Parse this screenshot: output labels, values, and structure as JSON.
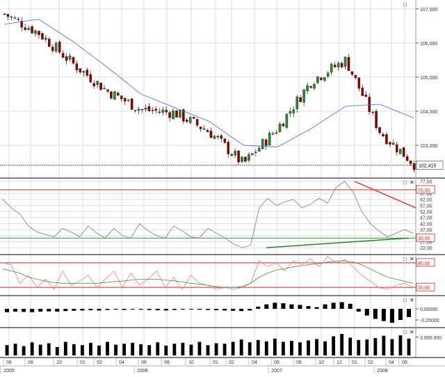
{
  "colors": {
    "candle_up": "#2f8a2f",
    "candle_down": "#8b0000",
    "ma": "#5577dd",
    "rsi_line": "#7a7a7a",
    "stoch_k": "#ff7b7b",
    "stoch_d": "#4a8f4a",
    "hist": "#000000",
    "volume": "#000000",
    "level_red": "#dd2222",
    "level_green": "#2a9a2a",
    "grid": "#dddddd",
    "axis_text": "#333333"
  },
  "chart_data": [
    {
      "type": "candlestick",
      "name": "price",
      "ylim": [
        102.1,
        107.2
      ],
      "ticks": [
        "107,000",
        "106,000",
        "105,000",
        "104,000",
        "103,000"
      ],
      "tick_values": [
        107.0,
        106.0,
        105.0,
        104.0,
        103.0
      ],
      "last_price_label": "102,415",
      "last_price": 102.415,
      "close_path": [
        106.85,
        106.3,
        105.4,
        104.6,
        104.05,
        103.95,
        103.4,
        102.45,
        103.5,
        104.9,
        105.5,
        103.4,
        102.45
      ],
      "ma_path": [
        106.55,
        106.7,
        106.05,
        105.3,
        104.5,
        104.1,
        103.7,
        103.0,
        102.95,
        103.5,
        104.15,
        104.2,
        103.8
      ]
    },
    {
      "type": "line",
      "name": "rsi",
      "ylim": [
        18,
        78
      ],
      "ticks": [
        "77,00",
        "67,00",
        "62,00",
        "57,00",
        "52,00",
        "47,00",
        "42,00",
        "37,00",
        "32,00",
        "27,00",
        "22,00"
      ],
      "tick_values": [
        77,
        67,
        62,
        57,
        52,
        47,
        42,
        37,
        32,
        27,
        22
      ],
      "levels": {
        "upper": 70,
        "lower": 30,
        "upper_label": "70,00",
        "lower_label": "30,00"
      },
      "values": [
        62,
        55,
        50,
        40,
        35,
        33,
        31,
        38,
        35,
        31,
        40,
        34,
        30,
        38,
        32,
        30,
        42,
        36,
        32,
        30,
        40,
        36,
        31,
        30,
        38,
        34,
        30,
        25,
        22,
        24,
        55,
        63,
        57,
        60,
        62,
        55,
        58,
        63,
        59,
        72,
        77,
        68,
        52,
        42,
        36,
        31,
        34,
        37,
        34
      ]
    },
    {
      "type": "line",
      "name": "stochastic",
      "ylim": [
        5,
        95
      ],
      "ticks": [
        "80,00",
        "20,00"
      ],
      "tick_values": [
        80,
        20
      ],
      "levels": {
        "upper": 80,
        "lower": 20,
        "upper_label": "80,00",
        "lower_label": "20,00"
      },
      "k_values": [
        80,
        75,
        30,
        50,
        20,
        40,
        15,
        60,
        25,
        35,
        50,
        20,
        40,
        60,
        20,
        55,
        25,
        40,
        60,
        20,
        45,
        15,
        50,
        30,
        25,
        15,
        20,
        15,
        20,
        30,
        85,
        70,
        80,
        60,
        85,
        75,
        90,
        70,
        95,
        80,
        88,
        70,
        50,
        35,
        20,
        15,
        25,
        30,
        20
      ],
      "d_values": [
        65,
        60,
        55,
        45,
        40,
        35,
        32,
        30,
        30,
        30,
        30,
        30,
        32,
        34,
        35,
        38,
        40,
        40,
        40,
        38,
        36,
        33,
        30,
        28,
        25,
        22,
        20,
        20,
        22,
        30,
        45,
        55,
        62,
        66,
        70,
        73,
        76,
        78,
        82,
        84,
        85,
        82,
        75,
        65,
        55,
        45,
        40,
        35,
        30
      ]
    },
    {
      "type": "bar",
      "name": "macd-histogram",
      "ylim": [
        -0.3,
        0.2
      ],
      "ticks": [
        "0,00000",
        "-0,20000"
      ],
      "tick_values": [
        0.0,
        -0.2
      ],
      "values": [
        -0.06,
        -0.05,
        -0.055,
        -0.06,
        -0.05,
        -0.045,
        -0.05,
        -0.04,
        -0.035,
        -0.03,
        -0.025,
        -0.03,
        -0.02,
        -0.015,
        -0.02,
        -0.01,
        -0.015,
        -0.02,
        -0.025,
        -0.03,
        -0.02,
        -0.015,
        -0.01,
        -0.015,
        -0.02,
        -0.025,
        -0.03,
        -0.035,
        -0.04,
        -0.03,
        0.04,
        0.08,
        0.11,
        0.1,
        0.08,
        0.07,
        0.05,
        0.03,
        0.08,
        0.11,
        0.12,
        0.09,
        -0.05,
        -0.12,
        -0.18,
        -0.22,
        -0.25,
        -0.2,
        -0.15
      ]
    },
    {
      "type": "bar",
      "name": "volume",
      "ylim": [
        0,
        5500000
      ],
      "ticks": [
        "3.900.000"
      ],
      "tick_values": [
        3900000
      ],
      "values": [
        2200000,
        2500000,
        2000000,
        2800000,
        2300000,
        2600000,
        1800000,
        2900000,
        2400000,
        2200000,
        2700000,
        2100000,
        2900000,
        2300000,
        2500000,
        2700000,
        2400000,
        2200000,
        2800000,
        2100000,
        2500000,
        2700000,
        2300000,
        2900000,
        2200000,
        2600000,
        2500000,
        2900000,
        3400000,
        2800000,
        3300000,
        3000000,
        3600000,
        2900000,
        3100000,
        2800000,
        3200000,
        3500000,
        3000000,
        4100000,
        4600000,
        3800000,
        3300000,
        3400000,
        3700000,
        4200000,
        3500000,
        4300000,
        3600000
      ]
    }
  ],
  "panels": {
    "price": {
      "icon_labels": [
        "□"
      ]
    },
    "rsi": {
      "icon_labels": [
        "□",
        "✕"
      ]
    },
    "stoch": {
      "icon_labels": [
        "□",
        "✕"
      ]
    },
    "macd": {
      "icon_labels": [
        "□",
        "✕"
      ]
    },
    "volume": {
      "icon_labels": [
        "□",
        "✕"
      ]
    }
  },
  "x_axis": {
    "months": [
      {
        "label": "06",
        "x": 13
      },
      {
        "label": "08",
        "x": 44
      },
      {
        "label": "10",
        "x": 85
      },
      {
        "label": "01",
        "x": 119
      },
      {
        "label": "02",
        "x": 143
      },
      {
        "label": "04",
        "x": 175
      },
      {
        "label": "06",
        "x": 207
      },
      {
        "label": "08",
        "x": 240
      },
      {
        "label": "10",
        "x": 275
      },
      {
        "label": "01",
        "x": 310
      },
      {
        "label": "02",
        "x": 333
      },
      {
        "label": "04",
        "x": 366
      },
      {
        "label": "06",
        "x": 398
      },
      {
        "label": "08",
        "x": 430
      },
      {
        "label": "10",
        "x": 462
      },
      {
        "label": "12",
        "x": 488
      },
      {
        "label": "01",
        "x": 510
      },
      {
        "label": "02",
        "x": 533
      },
      {
        "label": "04",
        "x": 563
      },
      {
        "label": "06",
        "x": 582
      }
    ],
    "years": [
      {
        "label": "2005",
        "x": 13
      },
      {
        "label": "2006",
        "x": 205
      },
      {
        "label": "2007",
        "x": 398
      },
      {
        "label": "2008",
        "x": 550
      }
    ]
  }
}
